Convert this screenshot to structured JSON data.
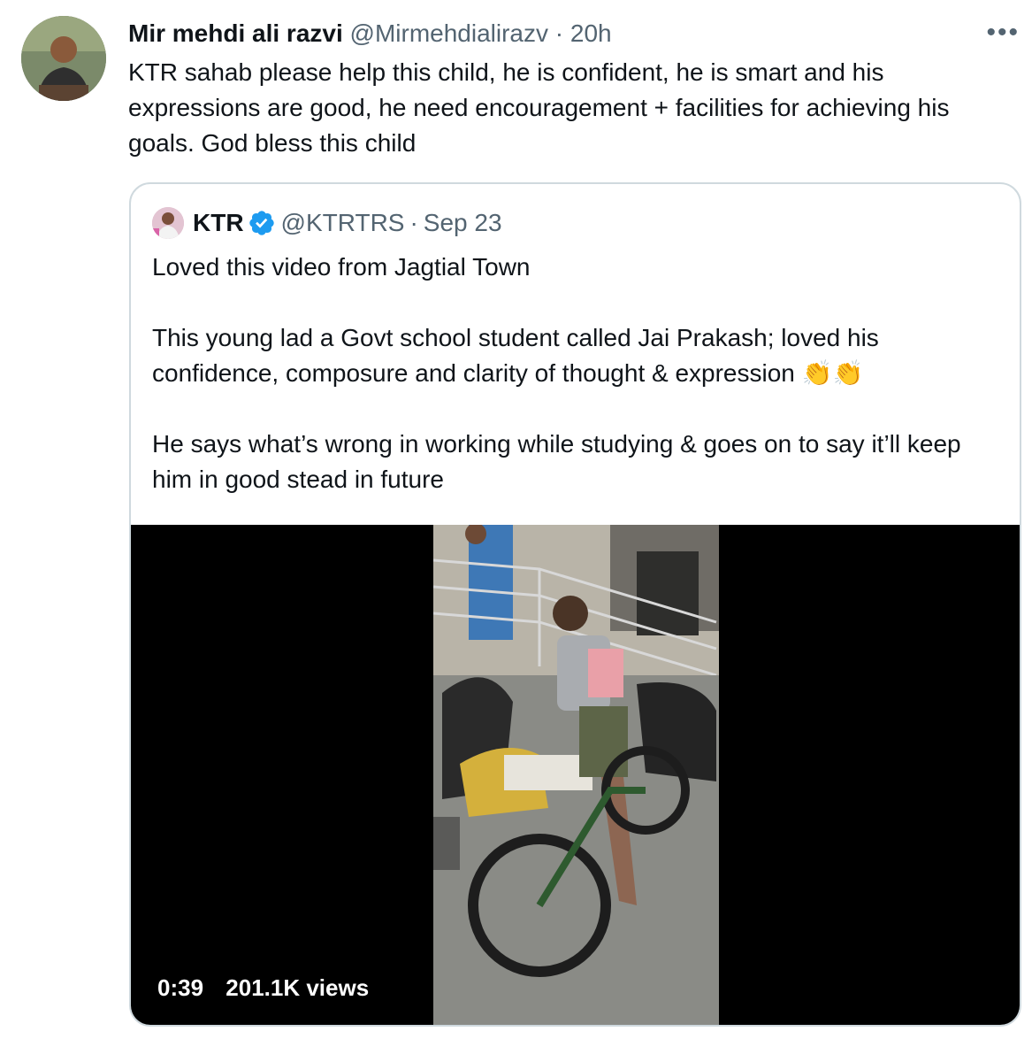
{
  "tweet": {
    "author_name": "Mir mehdi ali razvi",
    "author_handle": "@Mirmehdialirazv",
    "separator": "·",
    "time": "20h",
    "more_label": "•••",
    "text": "KTR sahab please help this child, he is confident, he is smart and his expressions are good, he need encouragement + facilities for achieving his goals. God bless this child"
  },
  "quoted_tweet": {
    "author_name": "KTR",
    "author_handle": "@KTRTRS",
    "separator": "·",
    "date": "Sep 23",
    "verified_icon": "verified-badge-icon",
    "text": "Loved this video from Jagtial Town\n\nThis young lad a Govt school student called Jai Prakash; loved his confidence, composure and clarity of thought & expression 👏👏\n\nHe says what’s wrong in working while studying & goes on to say it’ll keep him in good stead in future",
    "video": {
      "duration": "0:39",
      "views": "201.1K views"
    }
  },
  "colors": {
    "text_primary": "#0f1419",
    "text_secondary": "#536471",
    "border": "#cfd9de",
    "verified_blue": "#1d9bf0"
  }
}
